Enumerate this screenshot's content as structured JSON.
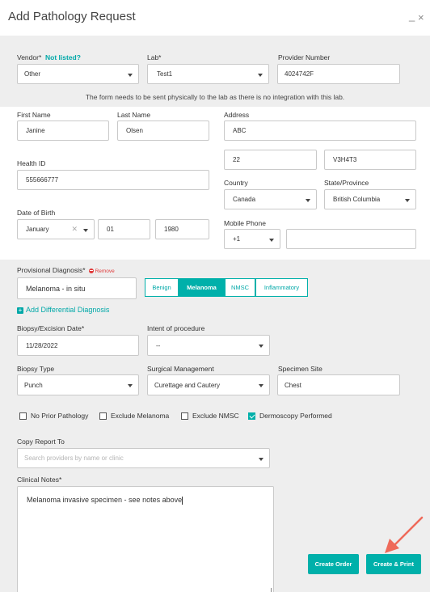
{
  "window": {
    "title": "Add Pathology Request",
    "minimize": "_",
    "close": "×"
  },
  "vendor": {
    "label": "Vendor*",
    "not_listed": "Not listed?",
    "value": "Other"
  },
  "lab": {
    "label": "Lab*",
    "value": "Test1"
  },
  "provider_number": {
    "label": "Provider Number",
    "value": "4024742F"
  },
  "notice": "The form needs to be sent physically to the lab as there is no integration with this lab.",
  "first_name": {
    "label": "First Name",
    "value": "Janine"
  },
  "last_name": {
    "label": "Last Name",
    "value": "Olsen"
  },
  "address": {
    "label": "Address",
    "line1": "ABC",
    "line2": "22",
    "postcode": "V3H4T3"
  },
  "health_id": {
    "label": "Health ID",
    "value": "555666777"
  },
  "country": {
    "label": "Country",
    "value": "Canada"
  },
  "state": {
    "label": "State/Province",
    "value": "British Columbia"
  },
  "dob": {
    "label": "Date of Birth",
    "month": "January",
    "day": "01",
    "year": "1980"
  },
  "mobile": {
    "label": "Mobile Phone",
    "code": "+1",
    "number": ""
  },
  "provisional_diagnosis": {
    "label": "Provisional Diagnosis*",
    "remove": "Remove",
    "value": "Melanoma - in situ"
  },
  "diagnosis_options": [
    "Benign",
    "Melanoma",
    "NMSC",
    "Inflammatory"
  ],
  "diagnosis_selected": "Melanoma",
  "add_differential": "Add Differential Diagnosis",
  "biopsy_date": {
    "label": "Biopsy/Excision Date*",
    "value": "11/28/2022"
  },
  "intent": {
    "label": "Intent of procedure",
    "value": "--"
  },
  "biopsy_type": {
    "label": "Biopsy Type",
    "value": "Punch"
  },
  "surgical": {
    "label": "Surgical Management",
    "value": "Curettage and Cautery"
  },
  "specimen_site": {
    "label": "Specimen Site",
    "value": "Chest"
  },
  "checks": [
    {
      "label": "No Prior Pathology",
      "checked": false
    },
    {
      "label": "Exclude Melanoma",
      "checked": false
    },
    {
      "label": "Exclude NMSC",
      "checked": false
    },
    {
      "label": "Dermoscopy Performed",
      "checked": true
    }
  ],
  "copy_report": {
    "label": "Copy Report To",
    "placeholder": "Search providers by name or clinic"
  },
  "clinical_notes": {
    "label": "Clinical Notes*",
    "value": "Melanoma invasive specimen - see notes above"
  },
  "buttons": {
    "create_order": "Create Order",
    "create_print": "Create & Print"
  },
  "colors": {
    "accent": "#00b0aa",
    "remove": "#e03a3a",
    "arrow": "#ee6a5a"
  }
}
